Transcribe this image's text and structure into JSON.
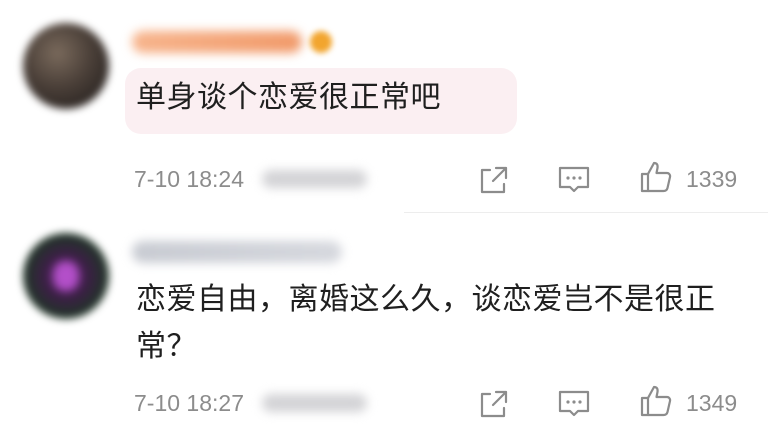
{
  "comments": [
    {
      "text": "单身谈个恋爱很正常吧",
      "time": "7-10 18:24",
      "likes": "1339",
      "text_lines": [
        "单身谈个恋爱很正常吧"
      ]
    },
    {
      "text": "恋爱自由，离婚这么久，谈恋爱岂不是很正常？",
      "time": "7-10 18:27",
      "likes": "1349",
      "text_lines": [
        "恋爱自由，离婚这么久，谈恋爱岂不是很正",
        "常？"
      ]
    }
  ],
  "icons": {
    "share": "share-icon",
    "reply": "reply-icon",
    "like": "thumbs-up-icon"
  },
  "colors": {
    "bubble": "#fbeff2",
    "meta_text": "#8c8c8c",
    "body_text": "#1f1f1f"
  }
}
